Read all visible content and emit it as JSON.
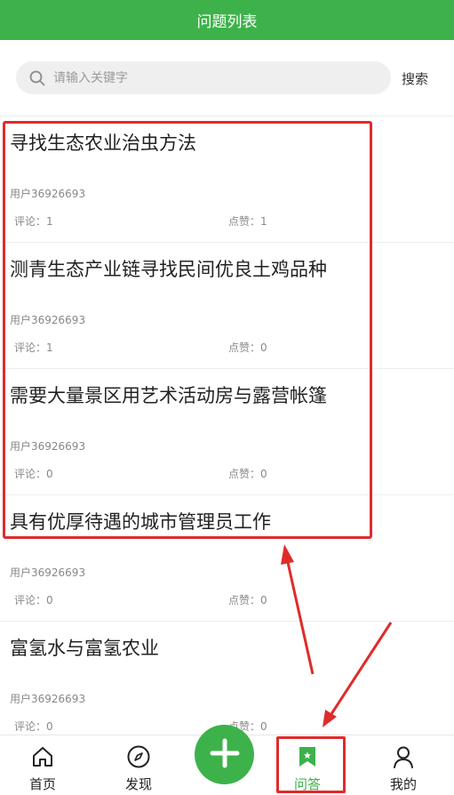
{
  "header": {
    "title": "问题列表"
  },
  "search": {
    "placeholder": "请输入关键字",
    "button_label": "搜索"
  },
  "questions": [
    {
      "title": "寻找生态农业治虫方法",
      "user": "用户36926693",
      "comments": "评论：1",
      "likes": "点赞：1"
    },
    {
      "title": "测青生态产业链寻找民间优良土鸡品种",
      "user": "用户36926693",
      "comments": "评论：1",
      "likes": "点赞：0"
    },
    {
      "title": "需要大量景区用艺术活动房与露营帐篷",
      "user": "用户36926693",
      "comments": "评论：0",
      "likes": "点赞：0"
    },
    {
      "title": "具有优厚待遇的城市管理员工作",
      "user": "用户36926693",
      "comments": "评论：0",
      "likes": "点赞：0"
    },
    {
      "title": "富氢水与富氢农业",
      "user": "用户36926693",
      "comments": "评论：0",
      "likes": "点赞：0"
    }
  ],
  "tabbar": {
    "items": [
      {
        "label": "首页",
        "icon": "home-icon"
      },
      {
        "label": "发现",
        "icon": "compass-icon"
      },
      {
        "label": "问答",
        "icon": "bookmark-star-icon",
        "active": true
      },
      {
        "label": "我的",
        "icon": "person-icon"
      }
    ],
    "fab_icon": "plus-icon"
  },
  "colors": {
    "brand": "#3db24a",
    "annotation": "#e02b2b"
  }
}
